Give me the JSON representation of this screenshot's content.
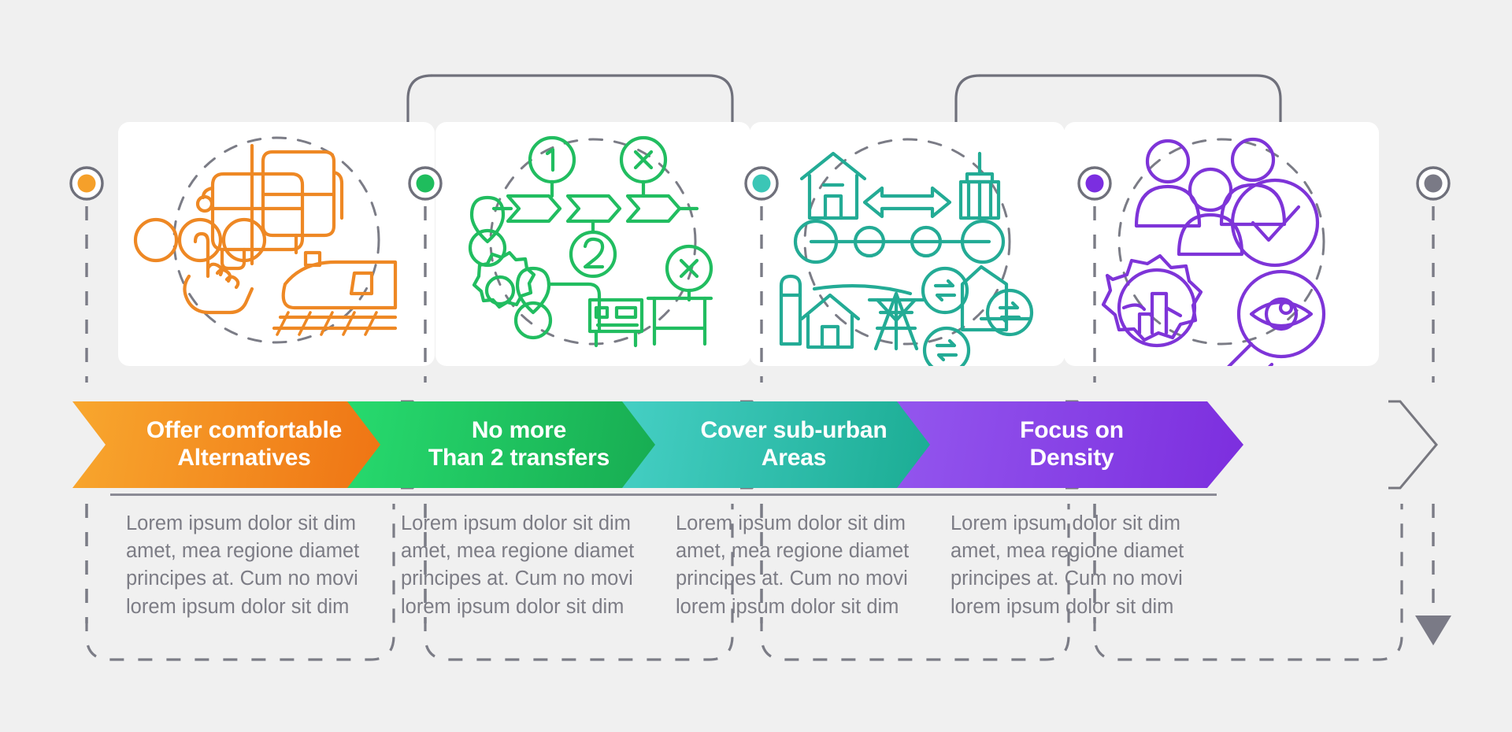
{
  "background_color": "#f0f0f0",
  "connector": {
    "line_color": "#6f707b",
    "dash_color": "#7b7c86",
    "end_arrow_name": "down-arrow-marker"
  },
  "steps": [
    {
      "id": "offer-comfortable-alternatives",
      "title": "Offer comfortable\nAlternatives",
      "body": "Lorem ipsum dolor sit dim\namet, mea regione diamet\nprincipes at. Cum no movi\nlorem ipsum dolor sit dim",
      "accent": "#f08a1e",
      "gradient_from": "#f8a72e",
      "gradient_to": "#ee6f11",
      "marker_color": "#f5a02a",
      "icon_name": "public-transport-options-icon",
      "icon_parts": [
        "bus-icon",
        "train-icon",
        "pointing-hand-icon",
        "passenger-circles-icon"
      ],
      "has_top_arc": false
    },
    {
      "id": "no-more-than-2-transfers",
      "title": "No more\nThan 2 transfers",
      "body": "Lorem ipsum dolor sit dim\namet, mea regione diamet\nprincipes at. Cum no movi\nlorem ipsum dolor sit dim",
      "accent": "#1fbf5f",
      "gradient_from": "#27da6e",
      "gradient_to": "#16a84f",
      "marker_color": "#1fbd5d",
      "icon_name": "transfer-limit-icon",
      "icon_parts": [
        "number-one-badge-icon",
        "number-two-badge-icon",
        "cancel-circle-icon",
        "map-pin-icon",
        "gear-icon",
        "bus-stop-icon"
      ],
      "has_top_arc": true
    },
    {
      "id": "cover-sub-urban-areas",
      "title": "Cover sub-urban\nAreas",
      "body": "Lorem ipsum dolor sit dim\namet, mea regione diamet\nprincipes at. Cum no movi\nlorem ipsum dolor sit dim",
      "accent": "#33c3b4",
      "gradient_from": "#45cfc4",
      "gradient_to": "#17a98f",
      "marker_color": "#3bc6b6",
      "icon_name": "suburban-coverage-icon",
      "icon_parts": [
        "house-icon",
        "double-arrow-icon",
        "skyscraper-icon",
        "transit-line-icon",
        "silo-icon",
        "power-tower-icon",
        "exchange-icon"
      ],
      "has_top_arc": false
    },
    {
      "id": "focus-on-density",
      "title": "Focus on\nDensity",
      "body": "Lorem ipsum dolor sit dim\namet, mea regione diamet\nprincipes at. Cum no movi\nlorem ipsum dolor sit dim",
      "accent": "#8040e0",
      "gradient_from": "#9356ee",
      "gradient_to": "#7c2ede",
      "marker_color": "#7b2ee0",
      "icon_name": "population-density-icon",
      "icon_parts": [
        "people-group-icon",
        "check-circle-icon",
        "gear-chart-icon",
        "magnifier-eye-icon"
      ],
      "has_top_arc": true
    }
  ],
  "end_marker": {
    "id": "end-marker",
    "marker_color": "#7a7a86"
  }
}
